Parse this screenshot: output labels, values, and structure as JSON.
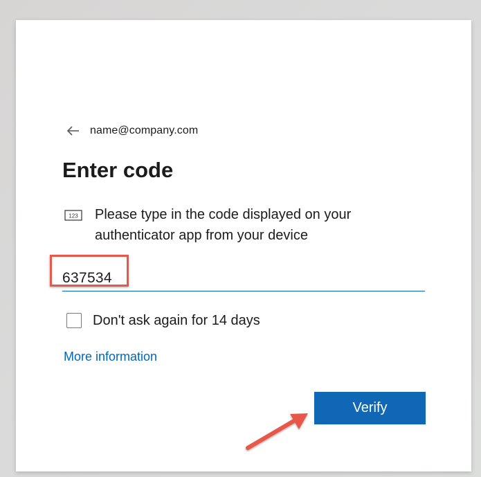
{
  "identity": {
    "email": "name@company.com",
    "back_icon": "arrow-left-icon"
  },
  "title": "Enter code",
  "instruction": {
    "icon": "numeric-code-icon",
    "icon_text": "123",
    "text": "Please type in the code displayed on your authenticator app from your device"
  },
  "code_input": {
    "value": "637534"
  },
  "remember": {
    "label": "Don't ask again for 14 days",
    "checked": false
  },
  "more_info": {
    "label": "More information"
  },
  "verify": {
    "label": "Verify"
  },
  "colors": {
    "accent": "#0067b8",
    "button": "#0f67b5",
    "annotation": "#e8584a"
  }
}
